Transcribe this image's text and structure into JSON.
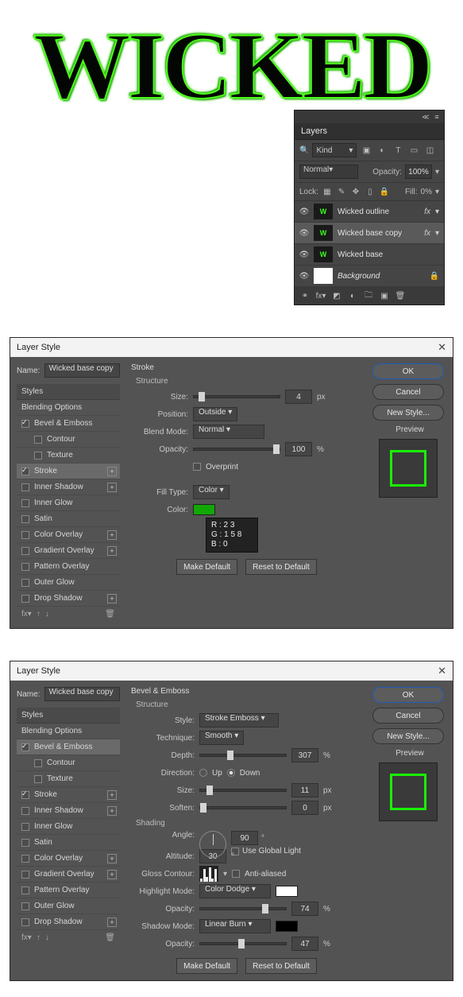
{
  "artwork": {
    "text": "WICKED"
  },
  "layers_panel": {
    "title": "Layers",
    "filter_label": "Kind",
    "blend_mode": "Normal",
    "opacity_label": "Opacity:",
    "opacity_value": "100%",
    "lock_label": "Lock:",
    "fill_label": "Fill:",
    "fill_value": "0%",
    "items": [
      {
        "name": "Wicked outline",
        "fx": true,
        "selected": false
      },
      {
        "name": "Wicked base copy",
        "fx": true,
        "selected": true
      },
      {
        "name": "Wicked base",
        "fx": false,
        "selected": false
      },
      {
        "name": "Background",
        "fx": false,
        "selected": false,
        "white": true,
        "locked": true
      }
    ]
  },
  "styles_list": {
    "header": "Styles",
    "items": [
      "Blending Options",
      "Bevel & Emboss",
      "Contour",
      "Texture",
      "Stroke",
      "Inner Shadow",
      "Inner Glow",
      "Satin",
      "Color Overlay",
      "Gradient Overlay",
      "Pattern Overlay",
      "Outer Glow",
      "Drop Shadow"
    ]
  },
  "dialog1": {
    "title": "Layer Style",
    "name_label": "Name:",
    "name_value": "Wicked base copy",
    "group": "Stroke",
    "structure_label": "Structure",
    "size_label": "Size:",
    "size_value": "4",
    "size_unit": "px",
    "position_label": "Position:",
    "position_value": "Outside",
    "blend_label": "Blend Mode:",
    "blend_value": "Normal",
    "opacity_label": "Opacity:",
    "opacity_value": "100",
    "opacity_unit": "%",
    "overprint_label": "Overprint",
    "filltype_label": "Fill Type:",
    "filltype_value": "Color",
    "color_label": "Color:",
    "rgb": {
      "r": "R : 2 3",
      "g": "G : 1 5 8",
      "b": "B : 0"
    },
    "make_default": "Make Default",
    "reset_default": "Reset to Default",
    "checked": {
      "bevel": true,
      "stroke": true
    },
    "selected": "Stroke",
    "buttons": {
      "ok": "OK",
      "cancel": "Cancel",
      "newstyle": "New Style...",
      "preview": "Preview"
    }
  },
  "dialog2": {
    "title": "Layer Style",
    "name_label": "Name:",
    "name_value": "Wicked base copy",
    "group": "Bevel & Emboss",
    "structure_label": "Structure",
    "style_label": "Style:",
    "style_value": "Stroke Emboss",
    "technique_label": "Technique:",
    "technique_value": "Smooth",
    "depth_label": "Depth:",
    "depth_value": "307",
    "depth_unit": "%",
    "direction_label": "Direction:",
    "up": "Up",
    "down": "Down",
    "size_label": "Size:",
    "size_value": "11",
    "size_unit": "px",
    "soften_label": "Soften:",
    "soften_value": "0",
    "soften_unit": "px",
    "shading_label": "Shading",
    "angle_label": "Angle:",
    "angle_value": "90",
    "global_label": "Use Global Light",
    "altitude_label": "Altitude:",
    "altitude_value": "30",
    "gloss_label": "Gloss Contour:",
    "anti_label": "Anti-aliased",
    "hl_mode_label": "Highlight Mode:",
    "hl_mode_value": "Color Dodge",
    "hl_op_label": "Opacity:",
    "hl_op_value": "74",
    "hl_unit": "%",
    "sh_mode_label": "Shadow Mode:",
    "sh_mode_value": "Linear Burn",
    "sh_op_label": "Opacity:",
    "sh_op_value": "47",
    "make_default": "Make Default",
    "reset_default": "Reset to Default",
    "checked": {
      "bevel": true,
      "stroke": true
    },
    "selected": "Bevel & Emboss",
    "buttons": {
      "ok": "OK",
      "cancel": "Cancel",
      "newstyle": "New Style...",
      "preview": "Preview"
    }
  }
}
